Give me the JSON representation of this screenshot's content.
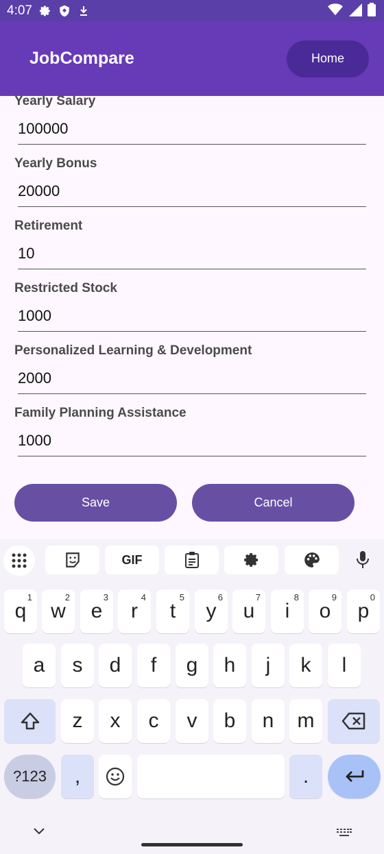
{
  "status_bar": {
    "time": "4:07",
    "icons": [
      "gear-icon",
      "shield-icon",
      "download-icon"
    ],
    "right_icons": [
      "wifi-icon",
      "signal-icon",
      "battery-icon"
    ]
  },
  "app_bar": {
    "title": "JobCompare",
    "home_label": "Home",
    "color": "#673ab7"
  },
  "form": {
    "fields": [
      {
        "label": "Yearly Salary",
        "value": "100000"
      },
      {
        "label": "Yearly Bonus",
        "value": "20000"
      },
      {
        "label": "Retirement",
        "value": "10"
      },
      {
        "label": "Restricted Stock",
        "value": "1000"
      },
      {
        "label": "Personalized Learning & Development",
        "value": "2000"
      },
      {
        "label": "Family Planning Assistance",
        "value": "1000"
      }
    ]
  },
  "actions": {
    "save_label": "Save",
    "cancel_label": "Cancel",
    "color": "#6750a4"
  },
  "keyboard": {
    "toolbar": [
      "apps-grid-icon",
      "sticker-icon",
      "GIF",
      "clipboard-icon",
      "gear-icon",
      "palette-icon",
      "mic-icon"
    ],
    "gif_label": "GIF",
    "row1": [
      {
        "key": "q",
        "hint": "1"
      },
      {
        "key": "w",
        "hint": "2"
      },
      {
        "key": "e",
        "hint": "3"
      },
      {
        "key": "r",
        "hint": "4"
      },
      {
        "key": "t",
        "hint": "5"
      },
      {
        "key": "y",
        "hint": "6"
      },
      {
        "key": "u",
        "hint": "7"
      },
      {
        "key": "i",
        "hint": "8"
      },
      {
        "key": "o",
        "hint": "9"
      },
      {
        "key": "p",
        "hint": "0"
      }
    ],
    "row2": [
      "a",
      "s",
      "d",
      "f",
      "g",
      "h",
      "j",
      "k",
      "l"
    ],
    "row3": [
      "z",
      "x",
      "c",
      "v",
      "b",
      "n",
      "m"
    ],
    "symbols_label": "?123",
    "comma": ",",
    "period": "."
  }
}
